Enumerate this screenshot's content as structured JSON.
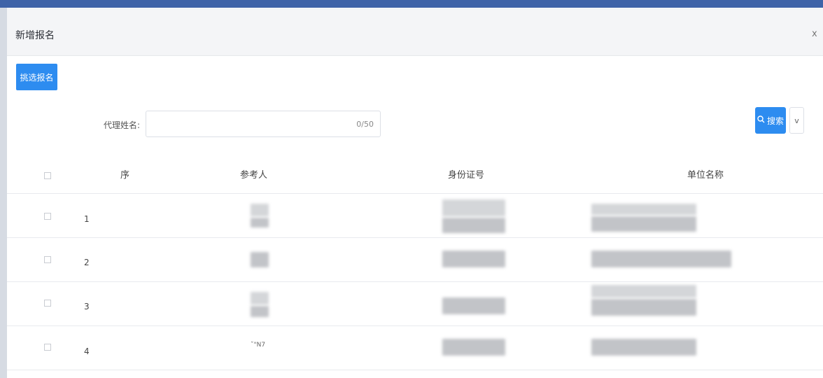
{
  "dialog": {
    "title": "新增报名",
    "close_label": "x",
    "pick_button": "挑选报名"
  },
  "filter": {
    "label": "代理姓名:",
    "value": "",
    "placeholder": "",
    "counter": "0/50",
    "search_label": "搜索",
    "search_icon": "search-icon",
    "expand_label": "v"
  },
  "table": {
    "headers": [
      "序",
      "参考人",
      "身份证号",
      "单位名称"
    ],
    "rows": [
      {
        "index": "1",
        "tiny": ""
      },
      {
        "index": "2",
        "tiny": ""
      },
      {
        "index": "3",
        "tiny": ""
      },
      {
        "index": "4",
        "tiny": "ˇ\"N7"
      }
    ]
  },
  "colors": {
    "primary": "#2d8cf0",
    "header_bg": "#f4f5f7",
    "topbar": "#3f63a8"
  }
}
